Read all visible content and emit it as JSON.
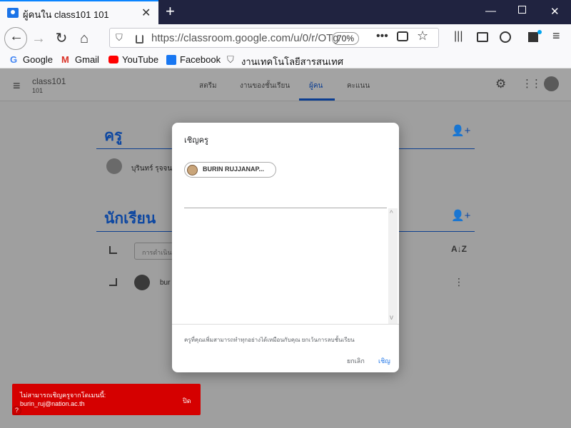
{
  "browser": {
    "tab_title": "ผู้คนใน class101 101",
    "url": "https://classroom.google.com/u/0/r/OTg",
    "zoom": "70%"
  },
  "bookmarks": [
    {
      "label": "Google",
      "icon": "google-icon"
    },
    {
      "label": "Gmail",
      "icon": "gmail-icon"
    },
    {
      "label": "YouTube",
      "icon": "youtube-icon"
    },
    {
      "label": "Facebook",
      "icon": "facebook-icon"
    },
    {
      "label": "งานเทคโนโลยีสารสนเทศ",
      "icon": "shield-icon"
    }
  ],
  "classroom": {
    "class_name": "class101",
    "section": "101",
    "tabs": [
      "สตรีม",
      "งานของชั้นเรียน",
      "ผู้คน",
      "คะแนน"
    ],
    "active_tab": "ผู้คน",
    "teachers_heading": "ครู",
    "teacher_name": "บุรินทร์ รุจจนพันธุ์",
    "students_heading": "นักเรียน",
    "actions_placeholder": "การดำเนิน",
    "student_name": "bur"
  },
  "dialog": {
    "title": "เชิญครู",
    "chip_name": "BURIN RUJJANAP...",
    "note": "ครูที่คุณเพิ่มสามารถทำทุกอย่างได้เหมือนกับคุณ ยกเว้นการลบชั้นเรียน",
    "cancel_label": "ยกเลิก",
    "invite_label": "เชิญ"
  },
  "toast": {
    "line1": "ไม่สามารถเชิญครูจากโดเมนนี้:",
    "line2": "burin_ruj@nation.ac.th",
    "close_label": "ปิด"
  },
  "colors": {
    "accent_blue": "#1a73e8",
    "heading_blue": "#0d47a1",
    "toast_red": "#d50000",
    "firefox_titlebar": "#202340"
  }
}
